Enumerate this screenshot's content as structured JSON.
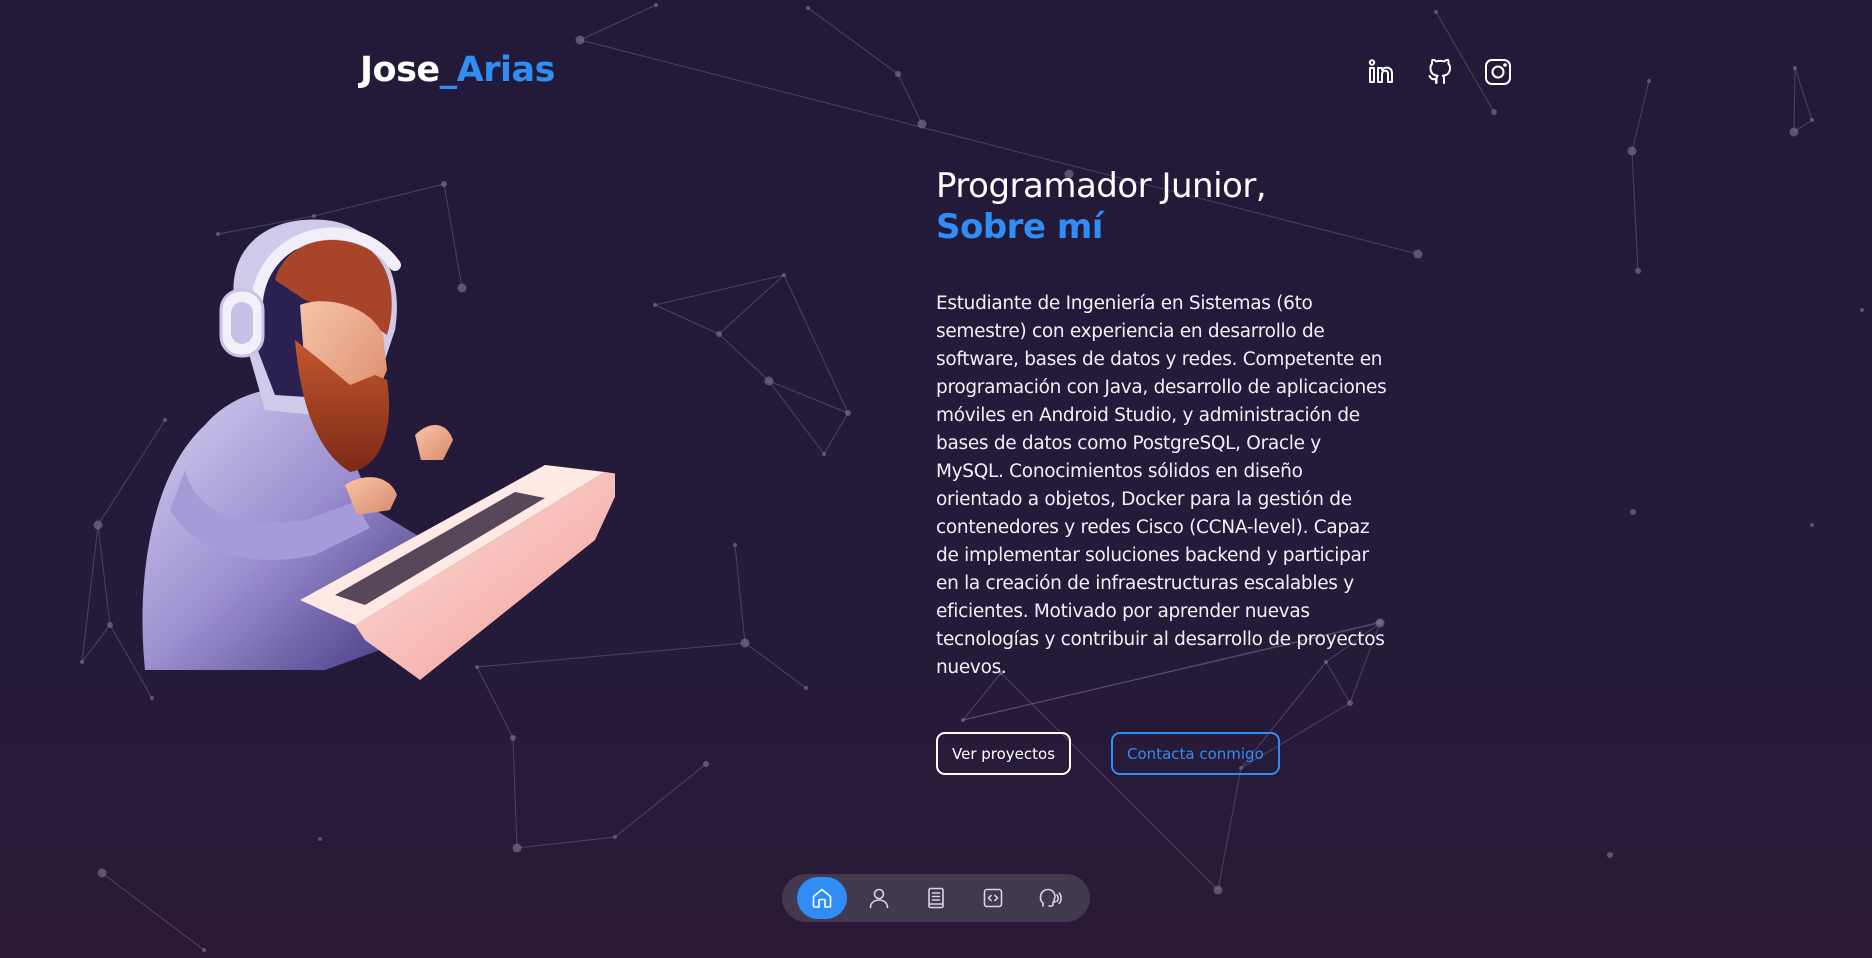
{
  "logo": {
    "first": "Jose",
    "separator": "_",
    "last": "Arias"
  },
  "socials": [
    {
      "name": "linkedin-icon"
    },
    {
      "name": "github-icon"
    },
    {
      "name": "instagram-icon"
    }
  ],
  "hero": {
    "title": "Programador Junior,",
    "subtitle": "Sobre mí",
    "description": "Estudiante de Ingeniería en Sistemas (6to semestre) con experiencia en desarrollo de software, bases de datos y redes. Competente en programación con Java, desarrollo de aplicaciones móviles en Android Studio, y administración de bases de datos como PostgreSQL, Oracle y MySQL. Conocimientos sólidos en diseño orientado a objetos, Docker para la gestión de contenedores y redes Cisco (CCNA-level). Capaz de implementar soluciones backend y participar en la creación de infraestructuras escalables y eficientes. Motivado por aprender nuevas tecnologías y contribuir al desarrollo de proyectos nuevos."
  },
  "actions": {
    "projects_label": "Ver proyectos",
    "contact_label": "Contacta conmigo"
  },
  "nav": [
    {
      "icon": "home-icon",
      "active": true
    },
    {
      "icon": "user-icon",
      "active": false
    },
    {
      "icon": "book-icon",
      "active": false
    },
    {
      "icon": "code-icon",
      "active": false
    },
    {
      "icon": "contact-icon",
      "active": false
    }
  ],
  "colors": {
    "accent": "#2f8df5",
    "background": "#221a38",
    "text": "#ffffff"
  }
}
